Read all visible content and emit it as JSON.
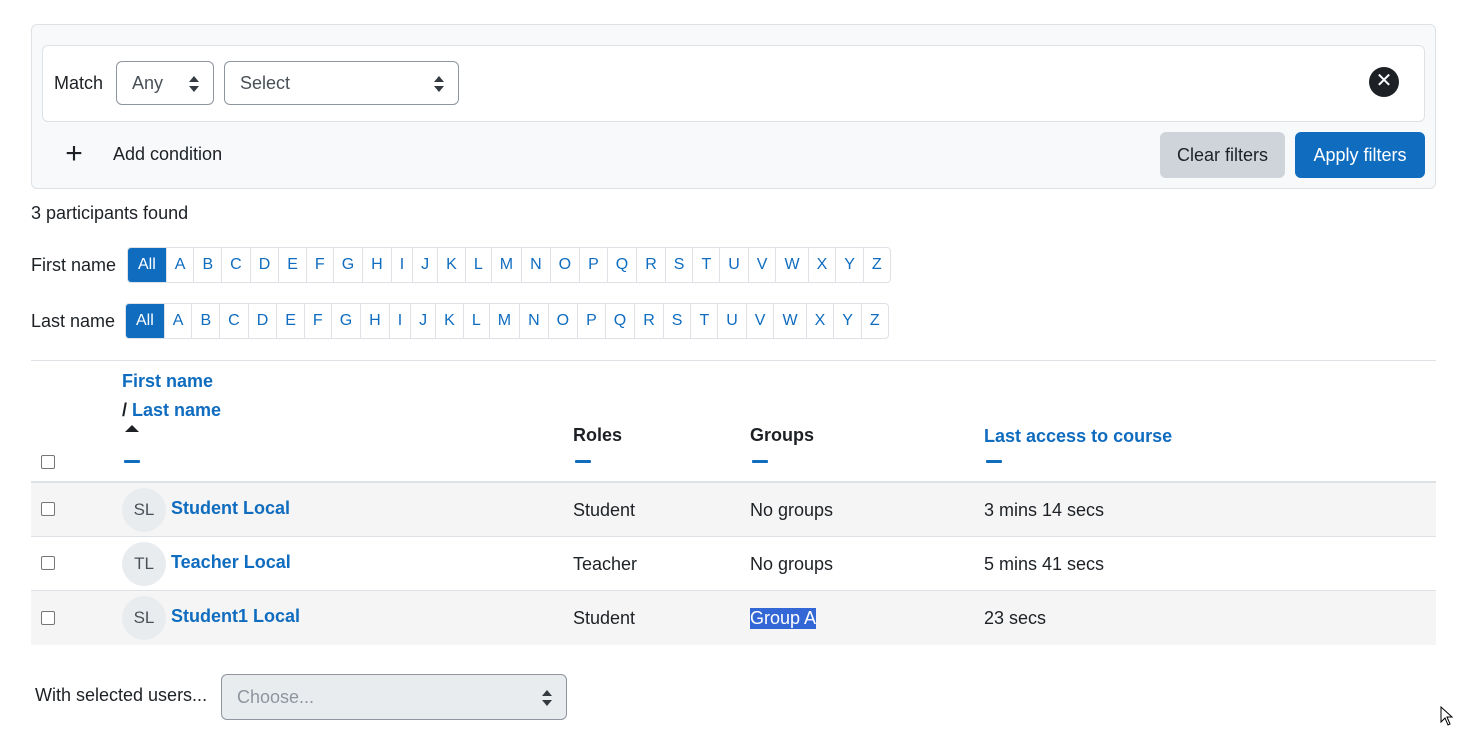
{
  "filter": {
    "match_label": "Match",
    "match_value": "Any",
    "type_value": "Select",
    "remove_symbol": "✕",
    "add_condition_label": "Add condition",
    "clear_label": "Clear filters",
    "apply_label": "Apply filters"
  },
  "participants_count": "3 participants found",
  "initials": {
    "first_label": "First name",
    "last_label": "Last name",
    "all_label": "All",
    "letters": [
      "A",
      "B",
      "C",
      "D",
      "E",
      "F",
      "G",
      "H",
      "I",
      "J",
      "K",
      "L",
      "M",
      "N",
      "O",
      "P",
      "Q",
      "R",
      "S",
      "T",
      "U",
      "V",
      "W",
      "X",
      "Y",
      "Z"
    ]
  },
  "table": {
    "headers": {
      "first_name": "First name",
      "separator": "/",
      "last_name": "Last name",
      "roles": "Roles",
      "groups": "Groups",
      "last_access": "Last access to course"
    },
    "rows": [
      {
        "initials": "SL",
        "name": "Student Local",
        "role": "Student",
        "group": "No groups",
        "last_access": "3 mins 14 secs"
      },
      {
        "initials": "TL",
        "name": "Teacher Local",
        "role": "Teacher",
        "group": "No groups",
        "last_access": "5 mins 41 secs"
      },
      {
        "initials": "SL",
        "name": "Student1 Local",
        "role": "Student",
        "group": "Group A",
        "last_access": "23 secs"
      }
    ]
  },
  "bulk": {
    "label": "With selected users...",
    "placeholder": "Choose..."
  },
  "colors": {
    "accent": "#0f6cbf",
    "selection": "#3367d6"
  }
}
